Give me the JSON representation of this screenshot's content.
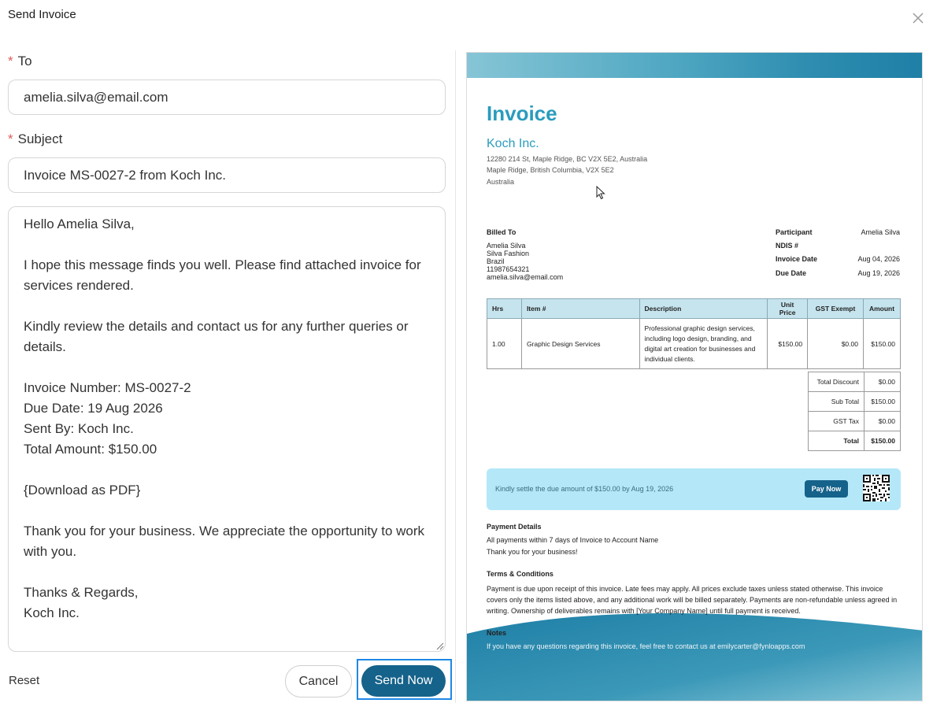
{
  "dialog": {
    "title": "Send Invoice"
  },
  "form": {
    "to_label": "To",
    "to_value": "amelia.silva@email.com",
    "subject_label": "Subject",
    "subject_value": "Invoice MS-0027-2 from Koch Inc.",
    "body": "Hello Amelia Silva,\n\nI hope this message finds you well. Please find attached invoice for services rendered.\n\nKindly review the details and contact us for any further queries or details.\n\nInvoice Number: MS-0027-2\nDue Date: 19 Aug 2026\nSent By: Koch Inc.\nTotal Amount: $150.00\n\n{Download as PDF}\n\nThank you for your business. We appreciate the opportunity to work with you.\n\nThanks & Regards,\nKoch Inc."
  },
  "actions": {
    "reset": "Reset",
    "cancel": "Cancel",
    "send": "Send Now"
  },
  "invoice": {
    "title": "Invoice",
    "company": "Koch Inc.",
    "address": [
      "12280 214 St, Maple Ridge, BC V2X 5E2, Australia",
      "Maple Ridge, British Columbia, V2X 5E2",
      "Australia"
    ],
    "billed_to_label": "Billed To",
    "billed_to": [
      "Amelia Silva",
      "Silva Fashion",
      "Brazil",
      "11987654321",
      "amelia.silva@email.com"
    ],
    "meta": [
      {
        "label": "Participant",
        "value": "Amelia Silva"
      },
      {
        "label": "NDIS #",
        "value": ""
      },
      {
        "label": "Invoice Date",
        "value": "Aug 04, 2026"
      },
      {
        "label": "Due Date",
        "value": "Aug 19, 2026"
      }
    ],
    "columns": [
      "Hrs",
      "Item #",
      "Description",
      "Unit Price",
      "GST Exempt",
      "Amount"
    ],
    "rows": [
      {
        "hrs": "1.00",
        "item": "Graphic Design Services",
        "description": "Professional graphic design services, including logo design, branding, and digital art creation for businesses and individual clients.",
        "unit_price": "$150.00",
        "gst_exempt": "$0.00",
        "amount": "$150.00"
      }
    ],
    "totals": [
      {
        "label": "Total Discount",
        "value": "$0.00"
      },
      {
        "label": "Sub Total",
        "value": "$150.00"
      },
      {
        "label": "GST Tax",
        "value": "$0.00"
      },
      {
        "label": "Total",
        "value": "$150.00"
      }
    ],
    "pay_banner_text": "Kindly settle the due amount of $150.00 by Aug 19, 2026",
    "pay_now": "Pay Now",
    "payment_details_title": "Payment Details",
    "payment_details": [
      "All payments within 7 days of Invoice to Account Name",
      "Thank you for your business!"
    ],
    "terms_title": "Terms & Conditions",
    "terms": "Payment is due upon receipt of this invoice. Late fees may apply. All prices exclude taxes unless stated otherwise. This invoice covers only the items listed above, and any additional work will be billed separately. Payments are non-refundable unless agreed in writing. Ownership of deliverables remains with [Your Company Name] until full payment is received.",
    "notes_title": "Notes",
    "notes": "If you have any questions regarding this invoice, feel free to contact us at emilycarter@fynloapps.com"
  },
  "colors": {
    "accent": "#15628a",
    "title_blue": "#2a9cbd",
    "banner": "#b4e8f8",
    "required": "#e05a5a",
    "focus": "#1e88e5"
  }
}
